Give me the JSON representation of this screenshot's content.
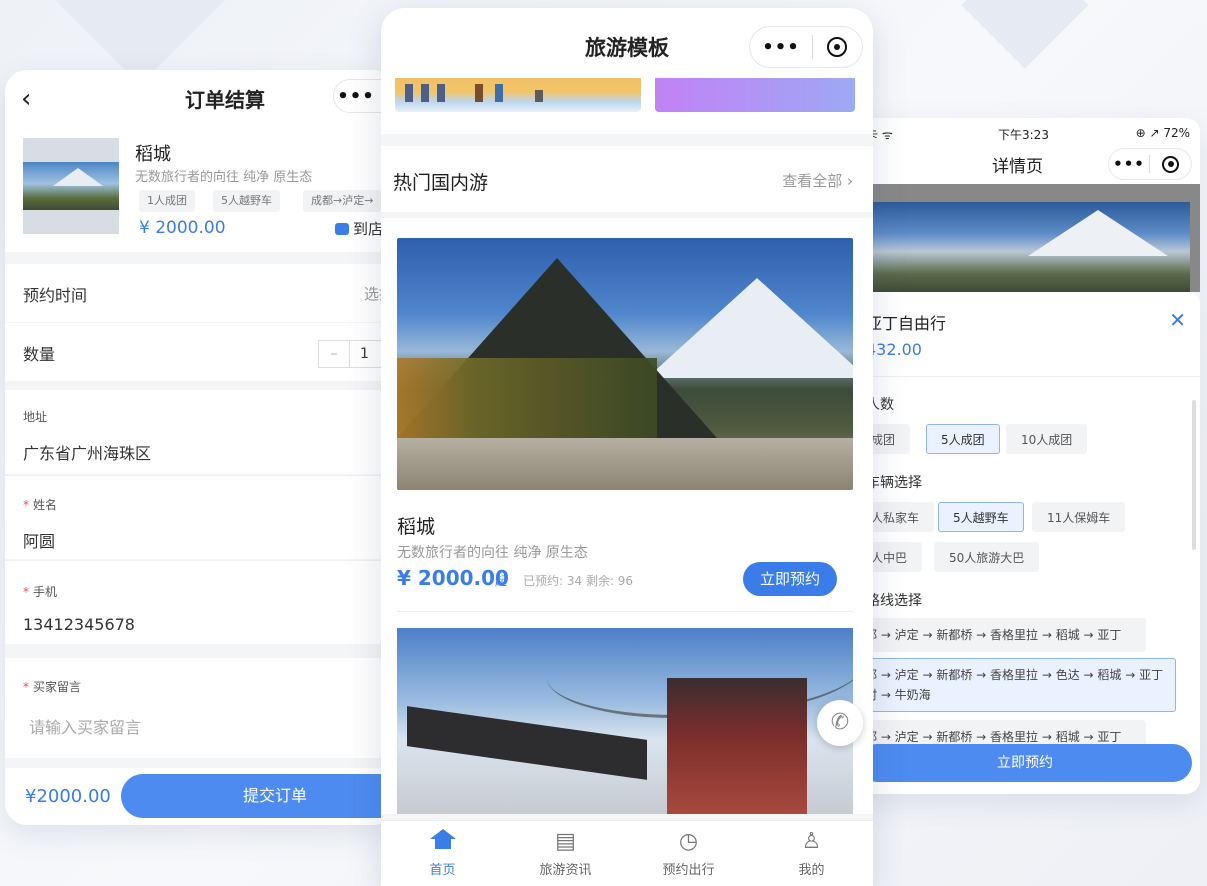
{
  "left": {
    "nav_title": "订单结算",
    "back_glyph": "‹",
    "capsule_dots": "•••",
    "product": {
      "name": "稻城",
      "desc": "无数旅行者的向往 纯净 原生态",
      "tags": [
        "1人成团",
        "5人越野车",
        "成都→泸定→"
      ],
      "price": "¥ 2000.00",
      "store_label": "到店"
    },
    "rows": {
      "time_label": "预约时间",
      "time_hint": "选择时",
      "qty_label": "数量",
      "qty_minus": "–",
      "qty_value": "1",
      "address_label": "地址",
      "address_value": "广东省广州海珠区",
      "name_label": "姓名",
      "name_value": "阿圆",
      "phone_label": "手机",
      "phone_value": "13412345678",
      "msg_label": "买家留言",
      "msg_placeholder": "请输入买家留言",
      "required_mark": "*"
    },
    "total": "¥2000.00",
    "submit": "提交订单"
  },
  "center": {
    "nav_title": "旅游模板",
    "capsule_dots": "•••",
    "section_title": "热门国内游",
    "see_all": "查看全部 ›",
    "item": {
      "name": "稻城",
      "desc": "无数旅行者的向往 纯净 原生态",
      "price": "¥ 2000.00",
      "price_suffix": "起",
      "stats": "已预约: 34  剩余: 96",
      "book_button": "立即预约"
    },
    "phone_glyph": "✆",
    "tabs": [
      {
        "label": "首页",
        "icon": "home-icon",
        "glyph": ""
      },
      {
        "label": "旅游资讯",
        "icon": "document-icon",
        "glyph": "▤"
      },
      {
        "label": "预约出行",
        "icon": "clock-icon",
        "glyph": "◷"
      },
      {
        "label": "我的",
        "icon": "user-icon",
        "glyph": "♙"
      }
    ],
    "active_color": "#3a7de8"
  },
  "right": {
    "status_left": "卡 ᯤ",
    "status_time": "下午3:23",
    "status_right": "⊕ ↗ 72%",
    "nav_title": "详情页",
    "capsule_dots": "•••",
    "sheet": {
      "title": "亚丁自由行",
      "close_glyph": "✕",
      "price": "432.00",
      "people_label": "人数",
      "people_options": [
        "成团",
        "5人成团",
        "10人成团"
      ],
      "vehicle_label": "车辆选择",
      "vehicle_options": [
        "人私家车",
        "5人越野车",
        "11人保姆车",
        "人中巴",
        "50人旅游大巴"
      ],
      "route_label": "路线选择",
      "routes": [
        "都 → 泸定 → 新都桥 → 香格里拉 → 稻城 → 亚丁",
        "都 → 泸定 → 新都桥 → 香格里拉 → 色达 → 稻城 → 亚丁村 → 牛奶海",
        "都 → 泸定 → 新都桥 → 香格里拉 → 稻城 → 亚丁"
      ],
      "book_button": "立即预约"
    }
  }
}
